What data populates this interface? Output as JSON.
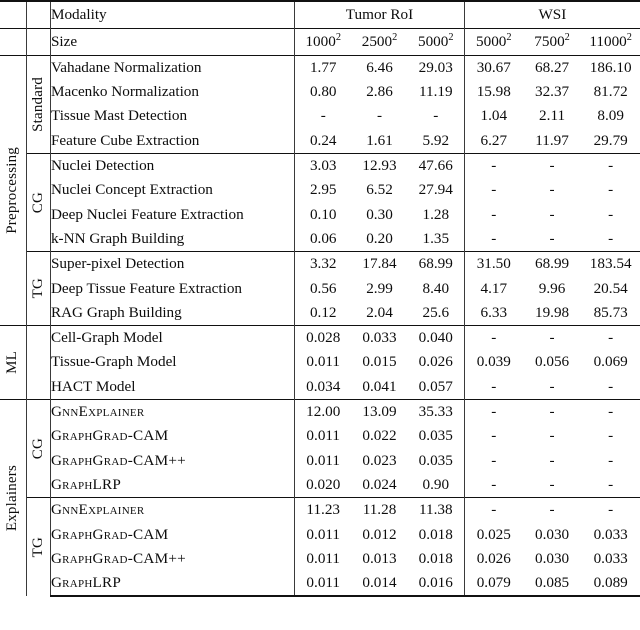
{
  "table": {
    "header": {
      "modality_label": "Modality",
      "size_label": "Size",
      "group_tumor": "Tumor RoI",
      "group_wsi": "WSI",
      "sizes_tumor": [
        "1000",
        "2500",
        "5000"
      ],
      "sizes_wsi": [
        "5000",
        "7500",
        "11000"
      ],
      "size_exponent": "2"
    },
    "sections": [
      {
        "label": "Preprocessing",
        "subgroups": [
          {
            "label": "Standard",
            "rows": [
              {
                "name": "Vahadane Normalization",
                "tumor": [
                  "1.77",
                  "6.46",
                  "29.03"
                ],
                "wsi": [
                  "30.67",
                  "68.27",
                  "186.10"
                ]
              },
              {
                "name": "Macenko Normalization",
                "tumor": [
                  "0.80",
                  "2.86",
                  "11.19"
                ],
                "wsi": [
                  "15.98",
                  "32.37",
                  "81.72"
                ]
              },
              {
                "name": "Tissue Mast Detection",
                "tumor": [
                  "-",
                  "-",
                  "-"
                ],
                "wsi": [
                  "1.04",
                  "2.11",
                  "8.09"
                ]
              },
              {
                "name": "Feature Cube Extraction",
                "tumor": [
                  "0.24",
                  "1.61",
                  "5.92"
                ],
                "wsi": [
                  "6.27",
                  "11.97",
                  "29.79"
                ]
              }
            ]
          },
          {
            "label": "CG",
            "rows": [
              {
                "name": "Nuclei Detection",
                "tumor": [
                  "3.03",
                  "12.93",
                  "47.66"
                ],
                "wsi": [
                  "-",
                  "-",
                  "-"
                ]
              },
              {
                "name": "Nuclei Concept Extraction",
                "tumor": [
                  "2.95",
                  "6.52",
                  "27.94"
                ],
                "wsi": [
                  "-",
                  "-",
                  "-"
                ]
              },
              {
                "name": "Deep Nuclei Feature Extraction",
                "tumor": [
                  "0.10",
                  "0.30",
                  "1.28"
                ],
                "wsi": [
                  "-",
                  "-",
                  "-"
                ]
              },
              {
                "name": "k-NN Graph Building",
                "tumor": [
                  "0.06",
                  "0.20",
                  "1.35"
                ],
                "wsi": [
                  "-",
                  "-",
                  "-"
                ]
              }
            ]
          },
          {
            "label": "TG",
            "rows": [
              {
                "name": "Super-pixel Detection",
                "tumor": [
                  "3.32",
                  "17.84",
                  "68.99"
                ],
                "wsi": [
                  "31.50",
                  "68.99",
                  "183.54"
                ]
              },
              {
                "name": "Deep Tissue Feature Extraction",
                "tumor": [
                  "0.56",
                  "2.99",
                  "8.40"
                ],
                "wsi": [
                  "4.17",
                  "9.96",
                  "20.54"
                ]
              },
              {
                "name": "RAG Graph Building",
                "tumor": [
                  "0.12",
                  "2.04",
                  "25.6"
                ],
                "wsi": [
                  "6.33",
                  "19.98",
                  "85.73"
                ]
              }
            ]
          }
        ]
      },
      {
        "label": "ML",
        "subgroups": [
          {
            "label": "",
            "rows": [
              {
                "name": "Cell-Graph Model",
                "tumor": [
                  "0.028",
                  "0.033",
                  "0.040"
                ],
                "wsi": [
                  "-",
                  "-",
                  "-"
                ]
              },
              {
                "name": "Tissue-Graph Model",
                "tumor": [
                  "0.011",
                  "0.015",
                  "0.026"
                ],
                "wsi": [
                  "0.039",
                  "0.056",
                  "0.069"
                ]
              },
              {
                "name": "HACT Model",
                "tumor": [
                  "0.034",
                  "0.041",
                  "0.057"
                ],
                "wsi": [
                  "-",
                  "-",
                  "-"
                ]
              }
            ]
          }
        ]
      },
      {
        "label": "Explainers",
        "subgroups": [
          {
            "label": "CG",
            "rows": [
              {
                "name": "GnnExplainer",
                "smallcaps": true,
                "tumor": [
                  "12.00",
                  "13.09",
                  "35.33"
                ],
                "wsi": [
                  "-",
                  "-",
                  "-"
                ]
              },
              {
                "name": "GraphGrad-CAM",
                "smallcaps": true,
                "tumor": [
                  "0.011",
                  "0.022",
                  "0.035"
                ],
                "wsi": [
                  "-",
                  "-",
                  "-"
                ]
              },
              {
                "name": "GraphGrad-CAM++",
                "smallcaps": true,
                "tumor": [
                  "0.011",
                  "0.023",
                  "0.035"
                ],
                "wsi": [
                  "-",
                  "-",
                  "-"
                ]
              },
              {
                "name": "GraphLRP",
                "smallcaps": true,
                "tumor": [
                  "0.020",
                  "0.024",
                  "0.90"
                ],
                "wsi": [
                  "-",
                  "-",
                  "-"
                ]
              }
            ]
          },
          {
            "label": "TG",
            "rows": [
              {
                "name": "GnnExplainer",
                "smallcaps": true,
                "tumor": [
                  "11.23",
                  "11.28",
                  "11.38"
                ],
                "wsi": [
                  "-",
                  "-",
                  "-"
                ]
              },
              {
                "name": "GraphGrad-CAM",
                "smallcaps": true,
                "tumor": [
                  "0.011",
                  "0.012",
                  "0.018"
                ],
                "wsi": [
                  "0.025",
                  "0.030",
                  "0.033"
                ]
              },
              {
                "name": "GraphGrad-CAM++",
                "smallcaps": true,
                "tumor": [
                  "0.011",
                  "0.013",
                  "0.018"
                ],
                "wsi": [
                  "0.026",
                  "0.030",
                  "0.033"
                ]
              },
              {
                "name": "GraphLRP",
                "smallcaps": true,
                "tumor": [
                  "0.011",
                  "0.014",
                  "0.016"
                ],
                "wsi": [
                  "0.079",
                  "0.085",
                  "0.089"
                ]
              }
            ]
          }
        ]
      }
    ]
  }
}
